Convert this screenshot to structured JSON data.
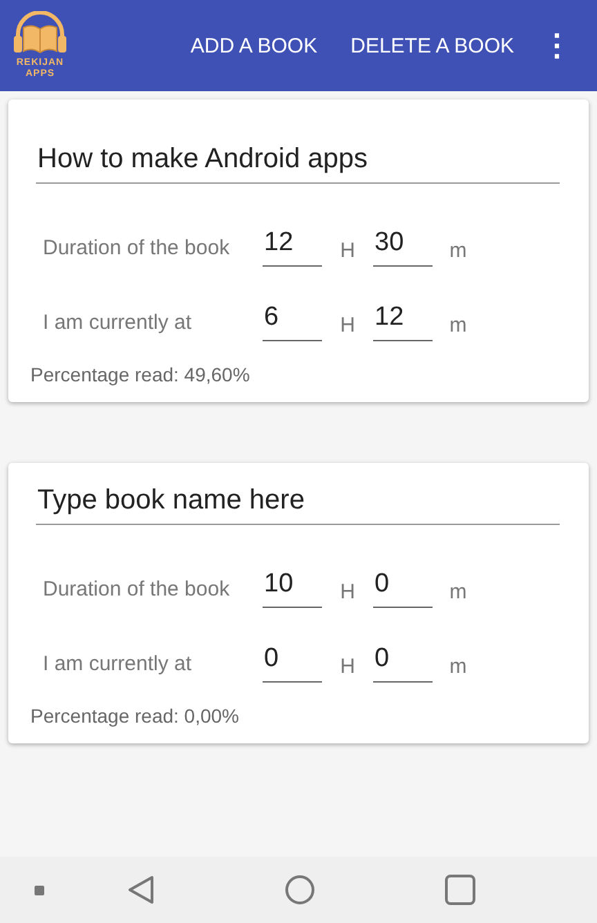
{
  "app_bar": {
    "logo_lines": [
      "REKIJAN",
      "APPS"
    ],
    "actions": [
      "ADD A BOOK",
      "DELETE A BOOK"
    ],
    "overflow": "⋮"
  },
  "books": [
    {
      "title": "How to make Android apps",
      "rows": [
        {
          "label": "Duration of the book",
          "hours": "12",
          "hour_unit": "H",
          "minutes": "30",
          "minute_unit": "m"
        },
        {
          "label": "I am currently at",
          "hours": "6",
          "hour_unit": "H",
          "minutes": "12",
          "minute_unit": "m"
        }
      ],
      "percentage": "Percentage read: 49,60%"
    },
    {
      "title": "Type book name here",
      "rows": [
        {
          "label": "Duration of the book",
          "hours": "10",
          "hour_unit": "H",
          "minutes": "0",
          "minute_unit": "m"
        },
        {
          "label": "I am currently at",
          "hours": "0",
          "hour_unit": "H",
          "minutes": "0",
          "minute_unit": "m"
        }
      ],
      "percentage": "Percentage read: 0,00%"
    }
  ]
}
